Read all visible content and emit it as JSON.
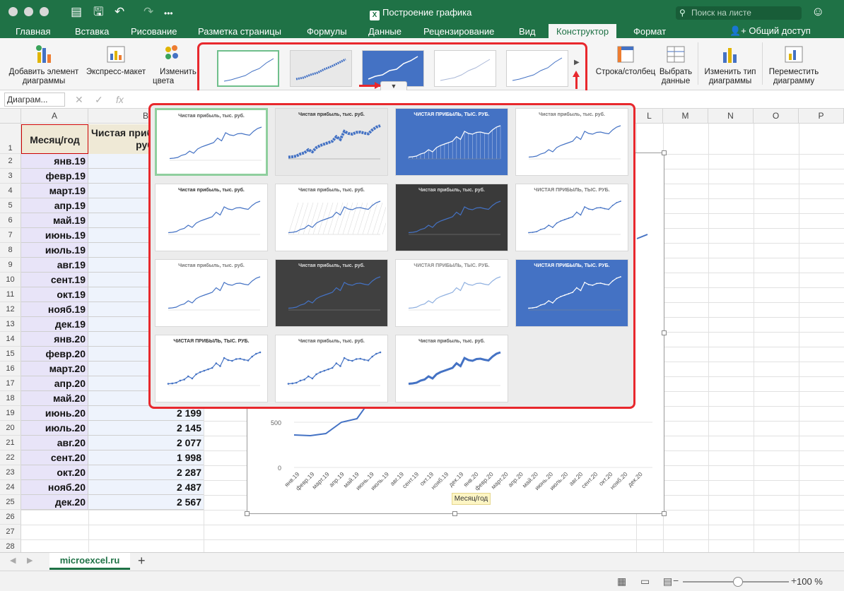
{
  "window": {
    "title": "Построение графика",
    "search_placeholder": "Поиск на листе"
  },
  "tabs": [
    "Главная",
    "Вставка",
    "Рисование",
    "Разметка страницы",
    "Формулы",
    "Данные",
    "Рецензирование",
    "Вид",
    "Конструктор",
    "Формат"
  ],
  "active_tab": "Конструктор",
  "share_label": "Общий доступ",
  "ribbon": {
    "add_element": "Добавить элемент диаграммы",
    "express_layout": "Экспресс-макет",
    "change_colors": "Изменить цвета",
    "row_col": "Строка/столбец",
    "select_data": "Выбрать данные",
    "change_type": "Изменить тип диаграммы",
    "move_chart": "Переместить диаграмму"
  },
  "formula_bar": {
    "name_box": "Диаграм...",
    "fx": "fx"
  },
  "columns": [
    "A",
    "B",
    "L",
    "M",
    "N",
    "O",
    "P"
  ],
  "table": {
    "header_a": "Месяц/год",
    "header_b": "Чистая прибыль, тыс. руб.",
    "months": [
      "янв.19",
      "февр.19",
      "март.19",
      "апр.19",
      "май.19",
      "июнь.19",
      "июль.19",
      "авг.19",
      "сент.19",
      "окт.19",
      "нояб.19",
      "дек.19",
      "янв.20",
      "февр.20",
      "март.20",
      "апр.20",
      "май.20",
      "июнь.20",
      "июль.20",
      "авг.20",
      "сент.20",
      "окт.20",
      "нояб.20",
      "дек.20"
    ],
    "values_visible": [
      "",
      "",
      "",
      "",
      "",
      "",
      "",
      "",
      "",
      "",
      "",
      "",
      "",
      "",
      "",
      "",
      "",
      "2 199",
      "2 145",
      "2 077",
      "1 998",
      "2 287",
      "2 487",
      "2 567"
    ]
  },
  "chart": {
    "chart_title": "Чистая прибыль, тыс. руб.",
    "axis_title": "Месяц/год",
    "y_ticks": [
      "0",
      "500"
    ],
    "x_labels": [
      "янв.19",
      "февр.19",
      "март.19",
      "апр.19",
      "май.19",
      "июнь.19",
      "июль.19",
      "авг.19",
      "сент.19",
      "окт.19",
      "нояб.19",
      "дек.19",
      "янв.20",
      "февр.20",
      "март.20",
      "апр.20",
      "май.20",
      "июнь.20",
      "июль.20",
      "авг.20",
      "сент.20",
      "окт.20",
      "нояб.20",
      "дек.20"
    ]
  },
  "gallery_titles": {
    "t1": "Чистая прибыль, тыс. руб.",
    "t_upper": "ЧИСТАЯ ПРИБЫЛЬ, ТЫС. РУБ."
  },
  "sheet_tab": "microexcel.ru",
  "zoom": "100 %",
  "colors": {
    "excel_green": "#1f7246",
    "highlight_red": "#e8282d",
    "series_blue": "#4472c4"
  }
}
